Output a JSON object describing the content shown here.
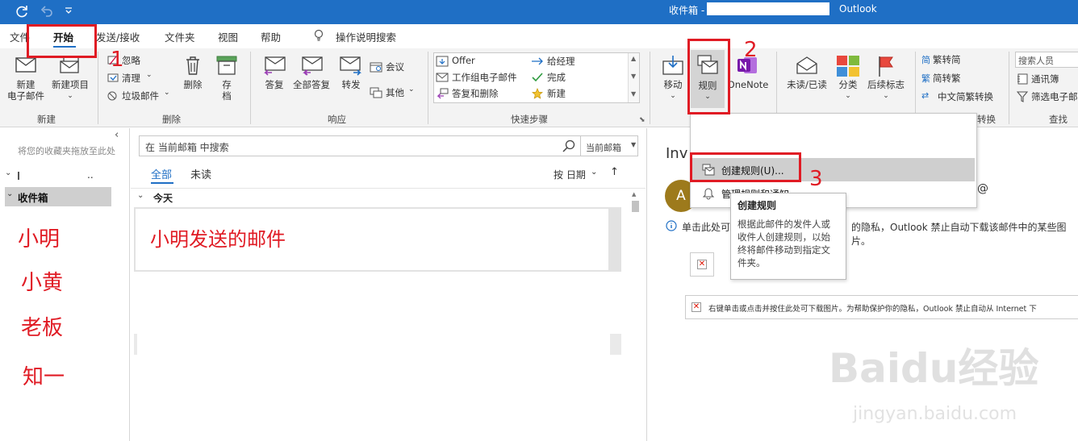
{
  "titlebar": {
    "mailbox": "收件箱 -",
    "app": "Outlook"
  },
  "tabs": [
    "文件",
    "开始",
    "发送/接收",
    "文件夹",
    "视图",
    "帮助"
  ],
  "tell_me": "操作说明搜索",
  "ribbon": {
    "new_email": [
      "新建",
      "电子邮件"
    ],
    "new_item": "新建项目",
    "group_new": "新建",
    "ignore": "忽略",
    "cleanup": "清理",
    "junk": "垃圾邮件",
    "delete": "删除",
    "archive": [
      "存",
      "档"
    ],
    "group_delete": "删除",
    "reply": "答复",
    "reply_all": "全部答复",
    "forward": "转发",
    "meeting": "会议",
    "more": "其他",
    "group_respond": "响应",
    "quicksteps": [
      "Offer",
      "给经理",
      "工作组电子邮件",
      "完成",
      "答复和删除",
      "新建"
    ],
    "group_quicksteps": "快速步骤",
    "move": "移动",
    "rules": "规则",
    "onenote": "OneNote",
    "unread_read": "未读/已读",
    "categorize": "分类",
    "followup": "后续标志",
    "to_traditional": "繁转简",
    "to_simplified": "简转繁",
    "convert": "中文简繁转换",
    "group_convert_tail": "转换",
    "search_people": "搜索人员",
    "address_book": "通讯簿",
    "filter_email": "筛选电子邮",
    "group_find": "查找"
  },
  "folder_pane": {
    "hint": "将您的收藏夹拖放至此处",
    "account_tail": "..",
    "inbox": "收件箱",
    "names": [
      "小明",
      "小黄",
      "老板",
      "知一"
    ]
  },
  "list": {
    "search_placeholder": "在 当前邮箱 中搜索",
    "scope": "当前邮箱",
    "filter_all": "全部",
    "filter_unread": "未读",
    "sort": "按 日期",
    "group_today": "今天",
    "mail_note": "小明发送的邮件"
  },
  "reading": {
    "subject": "Inv",
    "avatar": "A",
    "info_start": "单击此处可",
    "info_end": "的隐私，Outlook 禁止自动下载该邮件中的某些图片。",
    "at": "@",
    "image_notice": "右键单击或点击并按住此处可下载图片。为帮助保护你的隐私，Outlook 禁止自动从 Internet 下"
  },
  "rules_menu": {
    "create_rule": "创建规则(U)...",
    "manage_rules": "管理规则和通知"
  },
  "tooltip": {
    "title": "创建规则",
    "body": "根据此邮件的发件人或收件人创建规则，以始终将邮件移动到指定文件夹。"
  },
  "annotations": [
    "1",
    "2",
    "3"
  ],
  "watermark": {
    "brand": "Baidu经验",
    "url": "jingyan.baidu.com"
  },
  "colors": {
    "accent": "#1f6fc5",
    "annotation": "#e01b24"
  }
}
